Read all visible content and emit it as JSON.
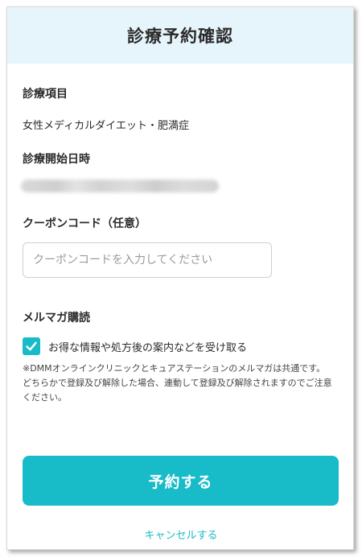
{
  "header": {
    "title": "診療予約確認"
  },
  "treatment": {
    "label": "診療項目",
    "value": "女性メディカルダイエット・肥満症"
  },
  "start_datetime": {
    "label": "診療開始日時"
  },
  "coupon": {
    "label": "クーポンコード（任意）",
    "placeholder": "クーポンコードを入力してください",
    "value": ""
  },
  "newsletter": {
    "label": "メルマガ購読",
    "checkbox_label": "お得な情報や処方後の案内などを受け取る",
    "checked": true,
    "note_line1": "※DMMオンラインクリニックとキュアステーションのメルマガは共通です。",
    "note_line2": "どちらかで登録及び解除した場合、連動して登録及び解除されますのでご注意ください。"
  },
  "actions": {
    "reserve_label": "予約する",
    "cancel_label": "キャンセルする"
  },
  "colors": {
    "accent": "#18bcc9",
    "header_bg": "#e6f4fb"
  },
  "icons": {
    "checkbox": "checkmark-icon"
  }
}
